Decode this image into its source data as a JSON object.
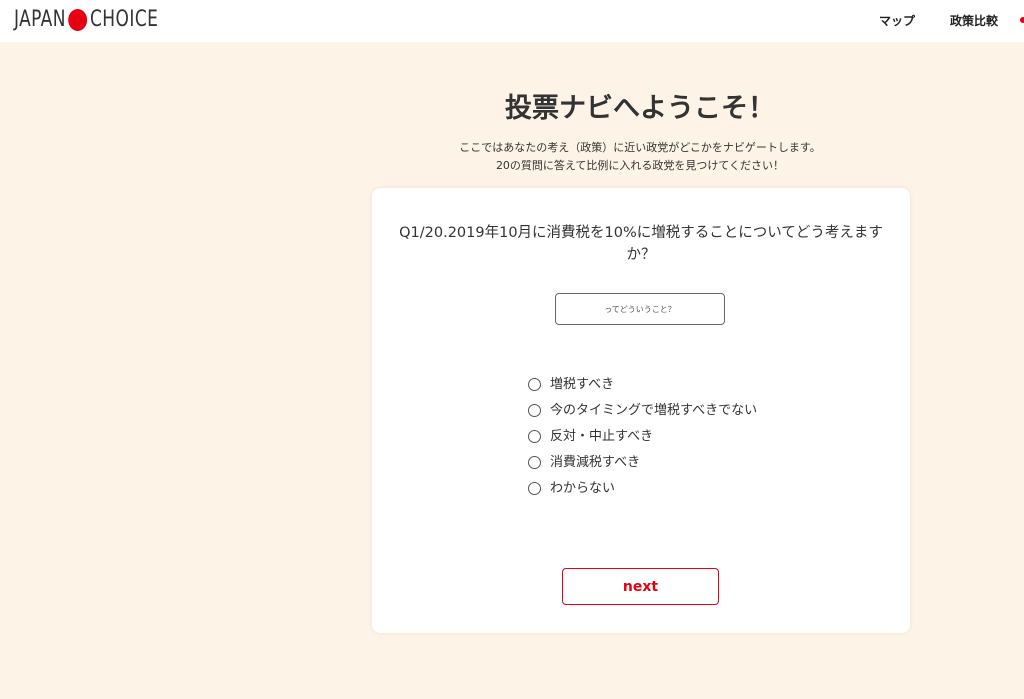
{
  "header": {
    "logo_left": "JAPAN",
    "logo_right": "CHOICE",
    "nav": [
      {
        "label": "マップ"
      },
      {
        "label": "政策比較"
      }
    ],
    "accent_color": "#e60012"
  },
  "intro": {
    "title": "投票ナビへようこそ！",
    "subtitle_line1": "ここではあなたの考え（政策）に近い政党がどこかをナビゲートします。",
    "subtitle_line2": "20の質問に答えて比例に入れる政党を見つけてください！"
  },
  "question": {
    "text": "Q1/20.2019年10月に消費税を10%に増税することについてどう考えますか？",
    "explain_button": "ってどういうこと？",
    "options": [
      {
        "label": "増税すべき"
      },
      {
        "label": "今のタイミングで増税すべきでない"
      },
      {
        "label": "反対・中止すべき"
      },
      {
        "label": "消費減税すべき"
      },
      {
        "label": "わからない"
      }
    ],
    "next_button": "next"
  }
}
